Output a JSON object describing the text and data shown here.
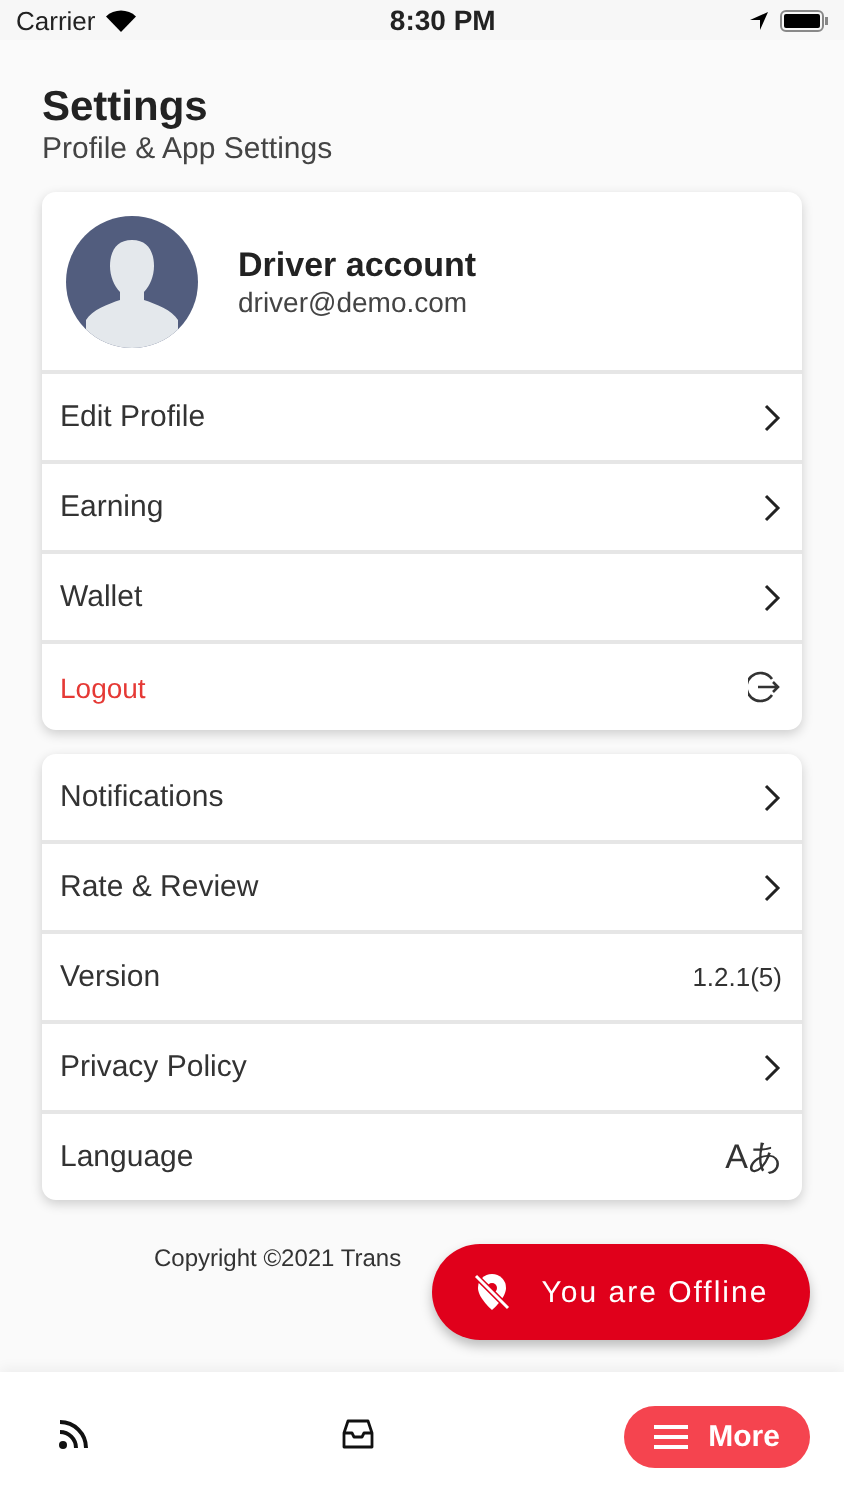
{
  "status_bar": {
    "carrier": "Carrier",
    "time": "8:30 PM"
  },
  "header": {
    "title": "Settings",
    "subtitle": "Profile & App Settings"
  },
  "profile": {
    "name": "Driver account",
    "email": "driver@demo.com"
  },
  "account_items": [
    {
      "label": "Edit Profile",
      "kind": "link"
    },
    {
      "label": "Earning",
      "kind": "link"
    },
    {
      "label": "Wallet",
      "kind": "link"
    },
    {
      "label": "Logout",
      "kind": "logout"
    }
  ],
  "app_items": [
    {
      "label": "Notifications",
      "kind": "link"
    },
    {
      "label": "Rate & Review",
      "kind": "link"
    },
    {
      "label": "Version",
      "kind": "value",
      "value": "1.2.1(5)"
    },
    {
      "label": "Privacy Policy",
      "kind": "link"
    },
    {
      "label": "Language",
      "kind": "value",
      "value": "Aあ"
    }
  ],
  "copyright": "Copyright ©2021 Trans",
  "offline_button": "You are Offline",
  "bottom_nav": {
    "more": "More"
  }
}
